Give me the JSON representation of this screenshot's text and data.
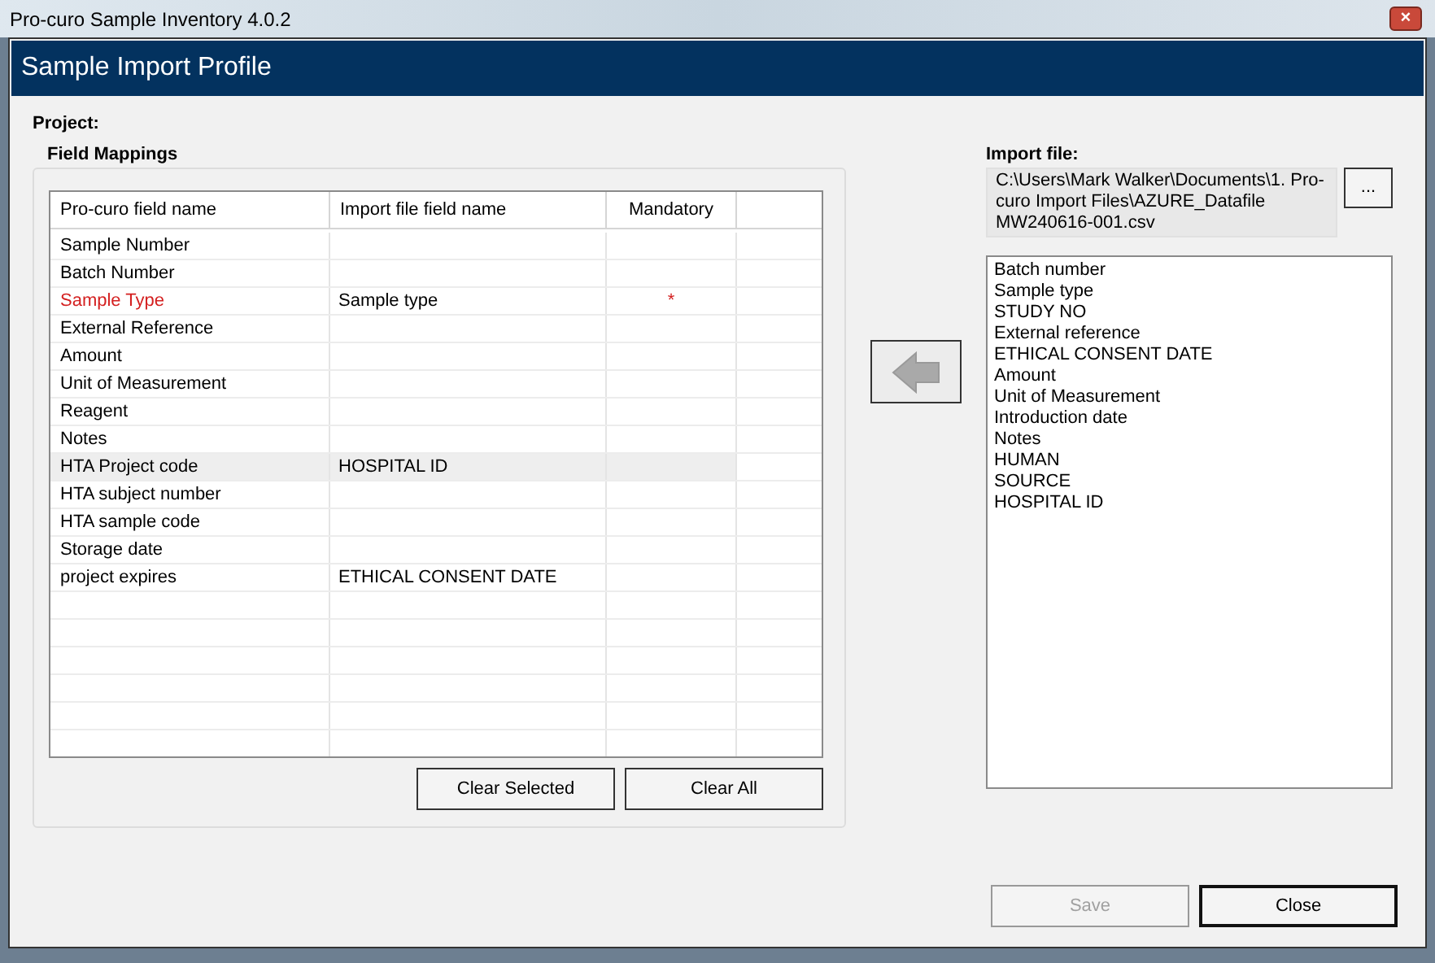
{
  "window": {
    "title": "Pro-curo Sample Inventory 4.0.2",
    "close": "×"
  },
  "dialog": {
    "title": "Sample Import Profile"
  },
  "project": {
    "label": "Project:"
  },
  "field_mappings": {
    "title": "Field Mappings",
    "columns": [
      "Pro-curo field name",
      "Import file field name",
      "Mandatory"
    ],
    "rows": [
      {
        "field": "Sample Number",
        "import": "",
        "mandatory": false,
        "selected": false
      },
      {
        "field": "Batch Number",
        "import": "",
        "mandatory": false,
        "selected": false
      },
      {
        "field": "Sample Type",
        "import": "Sample type",
        "mandatory": true,
        "mark": "*",
        "selected": false
      },
      {
        "field": "External Reference",
        "import": "",
        "mandatory": false,
        "selected": false
      },
      {
        "field": "Amount",
        "import": "",
        "mandatory": false,
        "selected": false
      },
      {
        "field": "Unit of Measurement",
        "import": "",
        "mandatory": false,
        "selected": false
      },
      {
        "field": "Reagent",
        "import": "",
        "mandatory": false,
        "selected": false
      },
      {
        "field": "Notes",
        "import": "",
        "mandatory": false,
        "selected": false
      },
      {
        "field": "HTA Project code",
        "import": "HOSPITAL ID",
        "mandatory": false,
        "selected": true
      },
      {
        "field": "HTA subject number",
        "import": "",
        "mandatory": false,
        "selected": false
      },
      {
        "field": "HTA sample code",
        "import": "",
        "mandatory": false,
        "selected": false
      },
      {
        "field": "Storage date",
        "import": "",
        "mandatory": false,
        "selected": false
      },
      {
        "field": "project expires",
        "import": "ETHICAL CONSENT DATE",
        "mandatory": false,
        "selected": false
      }
    ],
    "buttons": [
      {
        "label": "Clear Selected"
      },
      {
        "label": "Clear All"
      }
    ]
  },
  "import_file": {
    "label": "Import file:",
    "path": "C:\\Users\\Mark Walker\\Documents\\1. Pro-curo Import Files\\AZURE_Datafile MW240616-001.csv",
    "browse": "...",
    "fields": [
      "Batch number",
      "Sample type",
      "STUDY NO",
      "External reference",
      "ETHICAL CONSENT DATE",
      "Amount",
      "Unit of Measurement",
      "Introduction date",
      "Notes",
      "HUMAN",
      "SOURCE",
      "HOSPITAL ID"
    ]
  },
  "buttons": [
    {
      "label": "Save",
      "disabled": true
    },
    {
      "label": "Close",
      "disabled": false
    }
  ]
}
